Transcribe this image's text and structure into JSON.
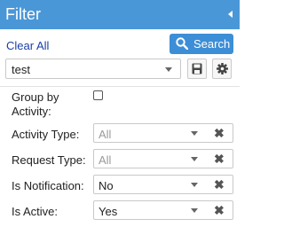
{
  "header": {
    "title": "Filter"
  },
  "toolbar": {
    "clear_label": "Clear All",
    "search_label": "Search"
  },
  "preset": {
    "value": "test"
  },
  "group_by": {
    "label": "Group by Activity:",
    "checked": false
  },
  "fields": [
    {
      "label": "Activity Type:",
      "value": "All",
      "is_placeholder": true
    },
    {
      "label": "Request Type:",
      "value": "All",
      "is_placeholder": true
    },
    {
      "label": "Is Notification:",
      "value": "No",
      "is_placeholder": false
    },
    {
      "label": "Is Active:",
      "value": "Yes",
      "is_placeholder": false
    }
  ],
  "icons": {
    "collapse": "triangle-left-icon",
    "search": "magnifier-icon",
    "save": "floppy-disk-icon",
    "settings": "gear-icon",
    "clear_field": "x-icon"
  },
  "colors": {
    "header_bg": "#4a97d8",
    "search_button_bg": "#3c8ed6",
    "link": "#1a3fa8"
  }
}
